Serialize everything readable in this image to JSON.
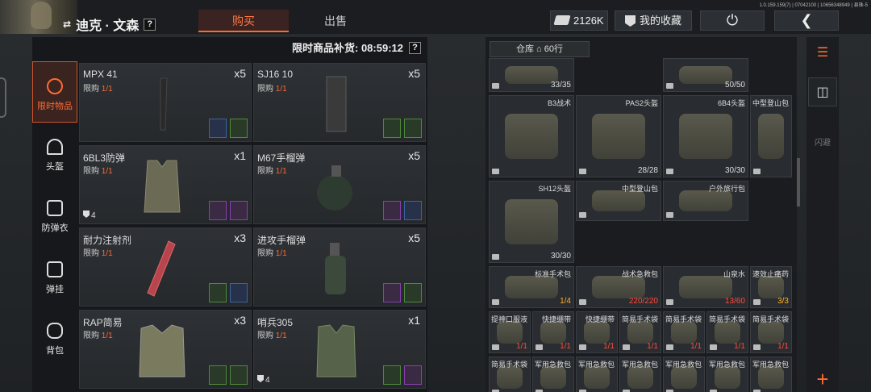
{
  "player": {
    "name": "迪克 · 文森",
    "help": "?"
  },
  "tabs": [
    {
      "label": "购买"
    },
    {
      "label": "出售"
    }
  ],
  "currency": {
    "amount": "2126K"
  },
  "favorites_label": "我的收藏",
  "version": "1.0.159.159(7) | 07042100 | 10656348949 | 县珠-5",
  "restock": {
    "label": "限时商品补货: 08:59:12",
    "help": "?"
  },
  "categories": [
    {
      "label": "限时物品",
      "icon": "clock-icon"
    },
    {
      "label": "头盔",
      "icon": "helmet-icon"
    },
    {
      "label": "防弹衣",
      "icon": "vest-icon"
    },
    {
      "label": "弹挂",
      "icon": "chest-rig-icon"
    },
    {
      "label": "背包",
      "icon": "backpack-icon"
    }
  ],
  "goods": [
    {
      "name": "MPX 41",
      "limit": "限购",
      "limit_val": "1/1",
      "qty": "x5",
      "armor": ""
    },
    {
      "name": "SJ16 10",
      "limit": "限购",
      "limit_val": "1/1",
      "qty": "x5",
      "armor": ""
    },
    {
      "name": "6BL3防弹",
      "limit": "限购",
      "limit_val": "1/1",
      "qty": "x1",
      "armor": "4"
    },
    {
      "name": "M67手榴弹",
      "limit": "限购",
      "limit_val": "1/1",
      "qty": "x5",
      "armor": ""
    },
    {
      "name": "耐力注射剂",
      "limit": "限购",
      "limit_val": "1/1",
      "qty": "x3",
      "armor": ""
    },
    {
      "name": "进攻手榴弹",
      "limit": "限购",
      "limit_val": "1/1",
      "qty": "x5",
      "armor": ""
    },
    {
      "name": "RAP简易",
      "limit": "限购",
      "limit_val": "1/1",
      "qty": "x3",
      "armor": ""
    },
    {
      "name": "哨兵305",
      "limit": "限购",
      "limit_val": "1/1",
      "qty": "x1",
      "armor": "4"
    }
  ],
  "warehouse": {
    "label": "仓库",
    "rows": "60行"
  },
  "inventory": [
    {
      "name": "",
      "durability": "33/35",
      "color": "normal"
    },
    {
      "name": "",
      "durability": "50/50",
      "color": "normal"
    },
    {
      "name": "B3战术",
      "durability": "",
      "color": "normal"
    },
    {
      "name": "PAS2头盔",
      "durability": "28/28",
      "color": "normal"
    },
    {
      "name": "6B4头盔",
      "durability": "30/30",
      "color": "normal"
    },
    {
      "name": "中型登山包",
      "durability": "",
      "color": "normal"
    },
    {
      "name": "SH12头盔",
      "durability": "30/30",
      "color": "normal"
    },
    {
      "name": "中型登山包",
      "durability": "",
      "color": "normal"
    },
    {
      "name": "户外旅行包",
      "durability": "",
      "color": "normal"
    },
    {
      "name": "标准手术包",
      "durability": "1/4",
      "color": "yellow"
    },
    {
      "name": "战术急救包",
      "durability": "220/220",
      "color": "red"
    },
    {
      "name": "山泉水",
      "durability": "13/60",
      "color": "red"
    },
    {
      "name": "速效止痛药",
      "durability": "3/3",
      "color": "yellow"
    },
    {
      "name": "提神口服液",
      "durability": "1/1",
      "color": "red"
    },
    {
      "name": "快捷绷带",
      "durability": "1/1",
      "color": "red"
    },
    {
      "name": "快捷绷带",
      "durability": "1/1",
      "color": "red"
    },
    {
      "name": "简易手术袋",
      "durability": "1/1",
      "color": "red"
    },
    {
      "name": "简易手术袋",
      "durability": "1/1",
      "color": "red"
    },
    {
      "name": "简易手术袋",
      "durability": "1/1",
      "color": "red"
    },
    {
      "name": "简易手术袋",
      "durability": "1/1",
      "color": "red"
    },
    {
      "name": "简易手术袋",
      "durability": "",
      "color": "red"
    },
    {
      "name": "军用急救包",
      "durability": "",
      "color": "red"
    },
    {
      "name": "军用急救包",
      "durability": "",
      "color": "red"
    },
    {
      "name": "军用急救包",
      "durability": "",
      "color": "red"
    },
    {
      "name": "军用急救包",
      "durability": "",
      "color": "red"
    },
    {
      "name": "军用急救包",
      "durability": "",
      "color": "red"
    },
    {
      "name": "军用急救包",
      "durability": "",
      "color": "red"
    }
  ],
  "side_labels": {
    "disabled": "闪避"
  },
  "colors": {
    "accent": "#ff6a30",
    "panel": "#16181b",
    "cell": "#292c30"
  }
}
